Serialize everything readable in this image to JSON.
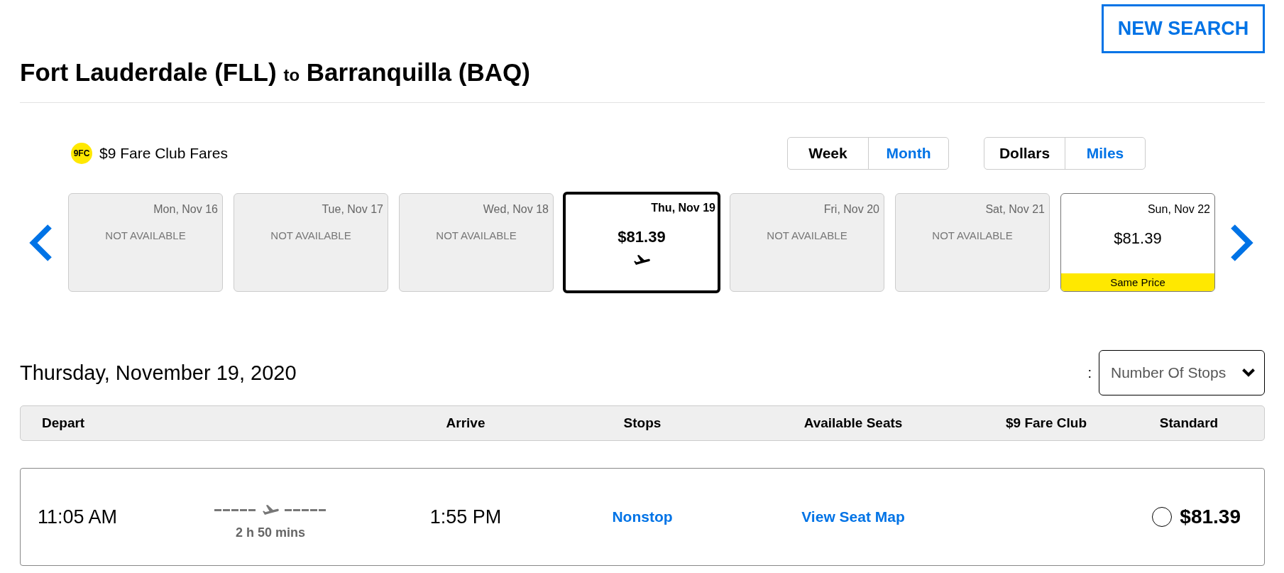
{
  "header": {
    "new_search_button": "NEW SEARCH",
    "route_title": {
      "origin": "Fort Lauderdale (FLL)",
      "connector": "to",
      "destination": "Barranquilla (BAQ)"
    }
  },
  "fare_legend": {
    "badge": "9FC",
    "label": "$9 Fare Club Fares"
  },
  "period_toggle": [
    {
      "label": "Week",
      "selected": true
    },
    {
      "label": "Month",
      "selected": false
    }
  ],
  "currency_toggle": [
    {
      "label": "Dollars",
      "selected": true
    },
    {
      "label": "Miles",
      "selected": false
    }
  ],
  "date_carousel": [
    {
      "kind": "unavailable",
      "date": "Mon, Nov 16",
      "status": "NOT AVAILABLE",
      "selected": false
    },
    {
      "kind": "unavailable",
      "date": "Tue, Nov 17",
      "status": "NOT AVAILABLE",
      "selected": false
    },
    {
      "kind": "unavailable",
      "date": "Wed, Nov 18",
      "status": "NOT AVAILABLE",
      "selected": false
    },
    {
      "kind": "available",
      "date": "Thu, Nov 19",
      "price": "$81.39",
      "selected": true
    },
    {
      "kind": "unavailable",
      "date": "Fri, Nov 20",
      "status": "NOT AVAILABLE",
      "selected": false
    },
    {
      "kind": "unavailable",
      "date": "Sat, Nov 21",
      "status": "NOT AVAILABLE",
      "selected": false
    },
    {
      "kind": "available",
      "date": "Sun, Nov 22",
      "price": "$81.39",
      "note": "Same Price",
      "selected": false
    }
  ],
  "results": {
    "date_heading": "Thursday, November 19, 2020",
    "sort": {
      "label": ":",
      "value": "Number Of Stops"
    },
    "columns": [
      "Depart",
      "Arrive",
      "Stops",
      "Available Seats",
      "$9 Fare Club",
      "Standard"
    ],
    "flights": [
      {
        "depart": "11:05 AM",
        "duration": "2 h 50 mins",
        "arrive": "1:55 PM",
        "stops": "Nonstop",
        "seats": "View Seat Map",
        "standard_fare": {
          "price": "$81.39",
          "selected": false
        }
      }
    ]
  }
}
